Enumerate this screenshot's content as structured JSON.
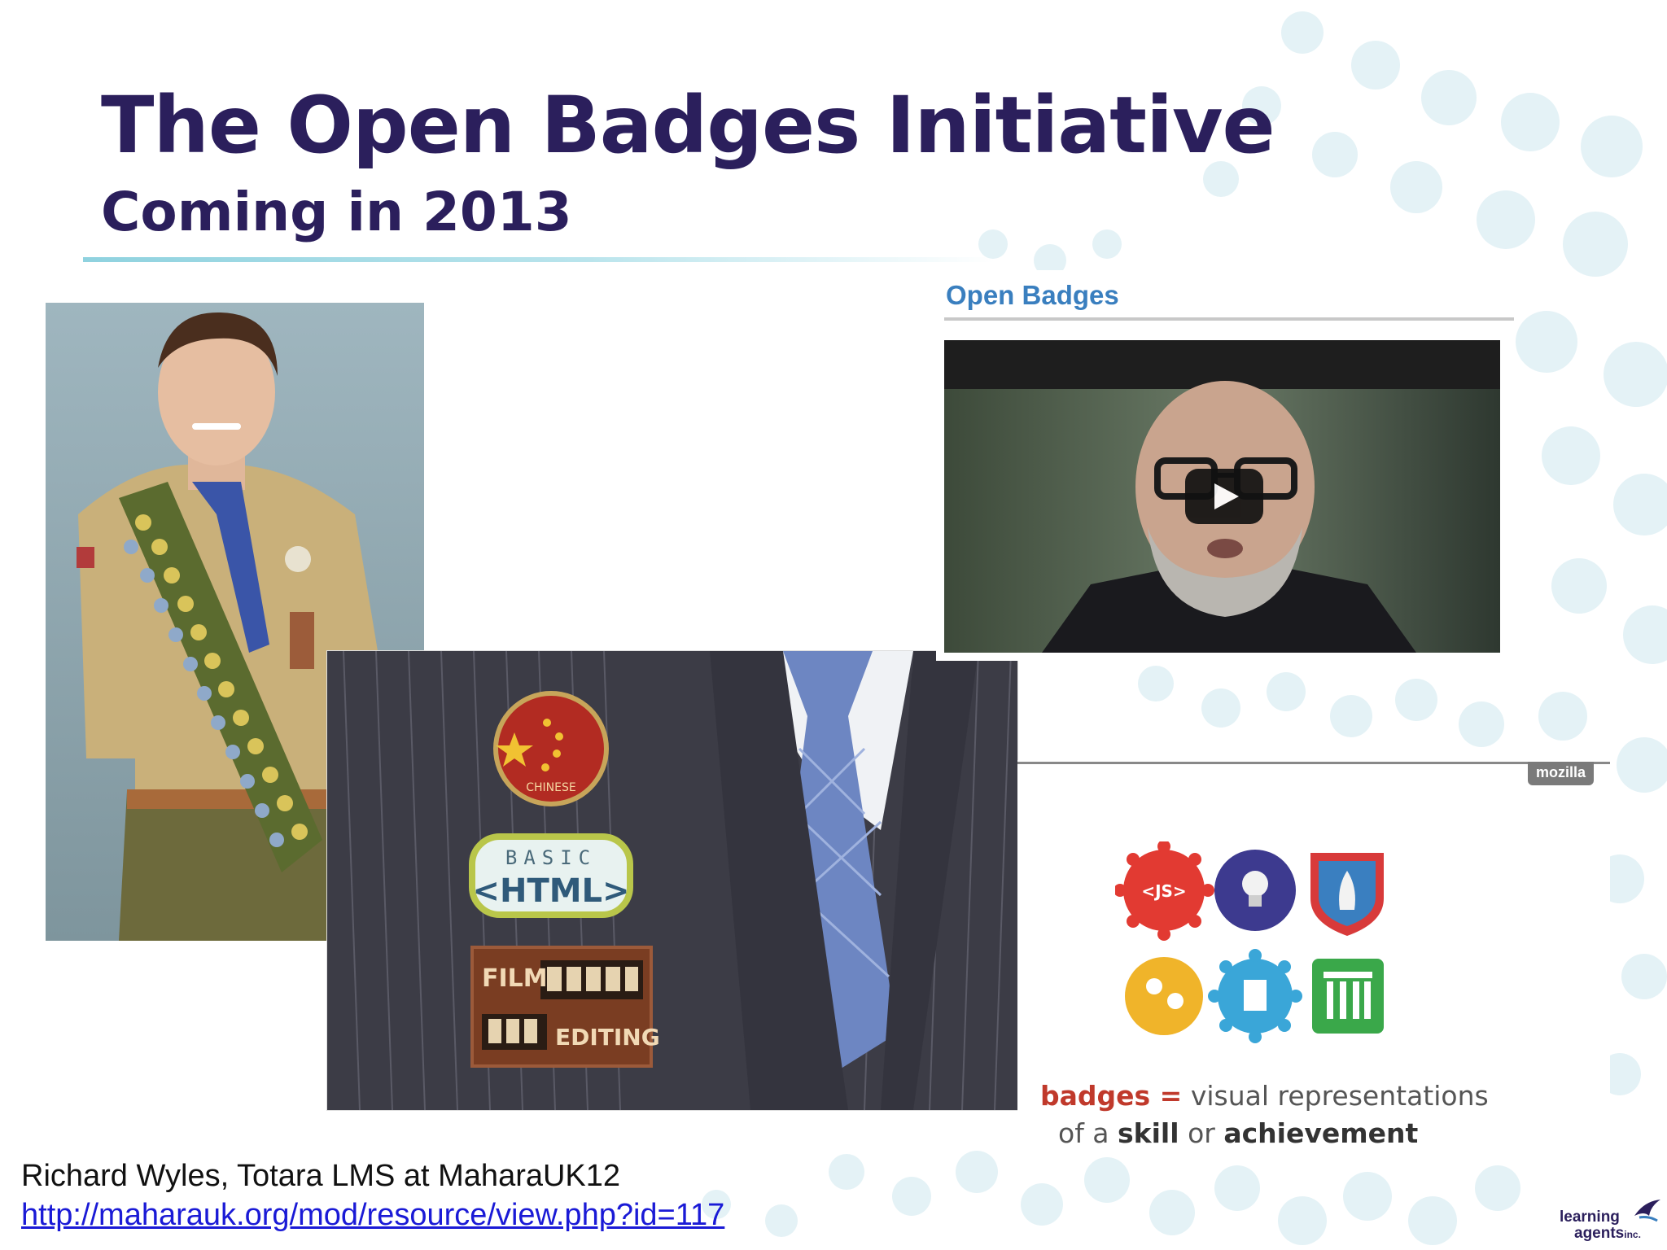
{
  "slide": {
    "title": "The Open Badges Initiative",
    "subtitle": "Coming in 2013",
    "accent_color": "#2b1f5c",
    "rule_color": "#8fd2df"
  },
  "video": {
    "heading": "Open Badges",
    "play_icon": "play-icon"
  },
  "suit_badges": {
    "top_badge": "CHINESE",
    "html_badge_line1": "BASIC",
    "html_badge_line2": "<HTML>",
    "film_badge_line1": "FILM",
    "film_badge_line2": "EDITING"
  },
  "badges_panel": {
    "brand": "mozilla",
    "js_badge": "<JS>",
    "caption": {
      "w1": "badges =",
      "w2": "visual representations",
      "w3": "of a",
      "w4": "skill",
      "w5": "or",
      "w6": "achievement"
    }
  },
  "footer": {
    "credit": "Richard Wyles, Totara LMS at MaharaUK12",
    "link": "http://maharauk.org/mod/resource/view.php?id=117"
  },
  "logo": {
    "line1": "learning",
    "line2": "agents",
    "suffix": "inc."
  }
}
